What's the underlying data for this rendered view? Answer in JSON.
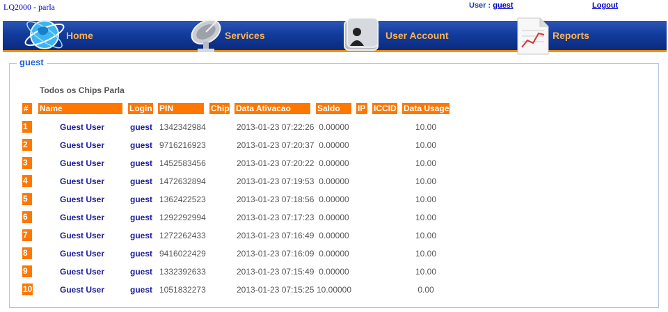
{
  "app_title": "LQ2000 - parla",
  "user_label": "User :",
  "username": "guest",
  "logout_label": "Logout",
  "nav": [
    {
      "label": "Home",
      "icon": "globe-icon"
    },
    {
      "label": "Services",
      "icon": "satellite-dish-icon"
    },
    {
      "label": "User Account",
      "icon": "user-folder-icon"
    },
    {
      "label": "Reports",
      "icon": "chart-report-icon"
    }
  ],
  "panel": {
    "legend": "guest",
    "title": "Todos os Chips Parla"
  },
  "table": {
    "headers": [
      "#",
      "Name",
      "Login",
      "PIN",
      "Chip",
      "Data Ativacao",
      "Saldo",
      "IP",
      "ICCID",
      "Data Usage"
    ],
    "rows": [
      {
        "num": "1",
        "name": "Guest User",
        "login": "guest",
        "pin": "1342342984",
        "chip": "",
        "date": "2013-01-23 07:22:26",
        "saldo": "0.00000",
        "ip": "",
        "iccid": "",
        "usage": "10.00"
      },
      {
        "num": "2",
        "name": "Guest User",
        "login": "guest",
        "pin": "9716216923",
        "chip": "",
        "date": "2013-01-23 07:20:37",
        "saldo": "0.00000",
        "ip": "",
        "iccid": "",
        "usage": "10.00"
      },
      {
        "num": "3",
        "name": "Guest User",
        "login": "guest",
        "pin": "1452583456",
        "chip": "",
        "date": "2013-01-23 07:20:22",
        "saldo": "0.00000",
        "ip": "",
        "iccid": "",
        "usage": "10.00"
      },
      {
        "num": "4",
        "name": "Guest User",
        "login": "guest",
        "pin": "1472632894",
        "chip": "",
        "date": "2013-01-23 07:19:53",
        "saldo": "0.00000",
        "ip": "",
        "iccid": "",
        "usage": "10.00"
      },
      {
        "num": "5",
        "name": "Guest User",
        "login": "guest",
        "pin": "1362422523",
        "chip": "",
        "date": "2013-01-23 07:18:56",
        "saldo": "0.00000",
        "ip": "",
        "iccid": "",
        "usage": "10.00"
      },
      {
        "num": "6",
        "name": "Guest User",
        "login": "guest",
        "pin": "1292292994",
        "chip": "",
        "date": "2013-01-23 07:17:23",
        "saldo": "0.00000",
        "ip": "",
        "iccid": "",
        "usage": "10.00"
      },
      {
        "num": "7",
        "name": "Guest User",
        "login": "guest",
        "pin": "1272262433",
        "chip": "",
        "date": "2013-01-23 07:16:49",
        "saldo": "0.00000",
        "ip": "",
        "iccid": "",
        "usage": "10.00"
      },
      {
        "num": "8",
        "name": "Guest User",
        "login": "guest",
        "pin": "9416022429",
        "chip": "",
        "date": "2013-01-23 07:16:09",
        "saldo": "0.00000",
        "ip": "",
        "iccid": "",
        "usage": "10.00"
      },
      {
        "num": "9",
        "name": "Guest User",
        "login": "guest",
        "pin": "1332392633",
        "chip": "",
        "date": "2013-01-23 07:15:49",
        "saldo": "0.00000",
        "ip": "",
        "iccid": "",
        "usage": "10.00"
      },
      {
        "num": "10",
        "name": "Guest User",
        "login": "guest",
        "pin": "1051832273",
        "chip": "",
        "date": "2013-01-23 07:15:25",
        "saldo": "10.00000",
        "ip": "",
        "iccid": "",
        "usage": "0.00"
      }
    ]
  },
  "colors": {
    "nav_blue": "#123c9c",
    "accent_orange": "#ff7700",
    "nav_label": "#ffb24a",
    "link_blue": "#1d1d9e"
  }
}
